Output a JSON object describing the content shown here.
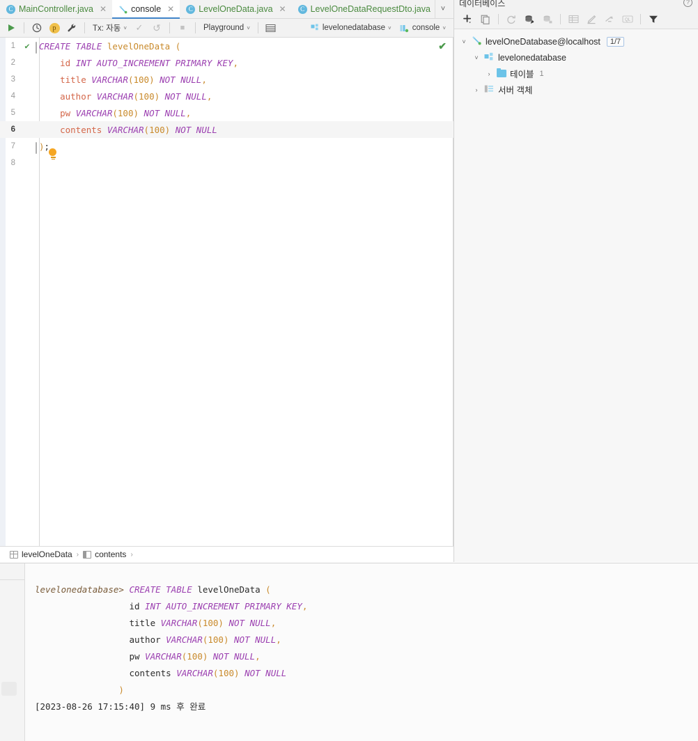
{
  "tabs": [
    {
      "label": "MainController.java",
      "icon": "java-class-icon",
      "active": false,
      "closable": true
    },
    {
      "label": "console",
      "icon": "console-query-icon",
      "active": true,
      "closable": true
    },
    {
      "label": "LevelOneData.java",
      "icon": "java-class-icon",
      "active": false,
      "closable": true
    },
    {
      "label": "LevelOneDataRequestDto.java",
      "icon": "java-class-icon",
      "active": false,
      "closable": false
    }
  ],
  "tabbar": {
    "overflow_label": "˅",
    "menu_label": "⋮"
  },
  "editor_toolbar": {
    "run_label": "▶",
    "history_label": "history-icon",
    "profile_label": "p",
    "wrench_label": "wrench-icon",
    "tx_label": "Tx: 자동",
    "commit_label": "✓",
    "rollback_label": "↺",
    "stop_label": "■",
    "schema_label": "Playground",
    "grid_label": "grid-icon",
    "datasource_label": "levelonedatabase",
    "session_label": "console",
    "caret": "˅"
  },
  "editor": {
    "ok_check": "✔",
    "line1_check": "✔",
    "lines": [
      {
        "no": "1",
        "current": false,
        "fold": true,
        "tokens": [
          {
            "t": "CREATE TABLE ",
            "c": "kw"
          },
          {
            "t": "levelOneData ",
            "c": "tbl"
          },
          {
            "t": "(",
            "c": "pun"
          }
        ]
      },
      {
        "no": "2",
        "current": false,
        "fold": false,
        "tokens": [
          {
            "t": "    id ",
            "c": "col"
          },
          {
            "t": "INT AUTO_INCREMENT PRIMARY KEY",
            "c": "kw"
          },
          {
            "t": ",",
            "c": "pun"
          }
        ]
      },
      {
        "no": "3",
        "current": false,
        "fold": false,
        "tokens": [
          {
            "t": "    title ",
            "c": "col"
          },
          {
            "t": "VARCHAR",
            "c": "kw"
          },
          {
            "t": "(",
            "c": "pun"
          },
          {
            "t": "100",
            "c": "num"
          },
          {
            "t": ") ",
            "c": "pun"
          },
          {
            "t": "NOT NULL",
            "c": "kw"
          },
          {
            "t": ",",
            "c": "pun"
          }
        ]
      },
      {
        "no": "4",
        "current": false,
        "fold": false,
        "tokens": [
          {
            "t": "    author ",
            "c": "col"
          },
          {
            "t": "VARCHAR",
            "c": "kw"
          },
          {
            "t": "(",
            "c": "pun"
          },
          {
            "t": "100",
            "c": "num"
          },
          {
            "t": ") ",
            "c": "pun"
          },
          {
            "t": "NOT NULL",
            "c": "kw"
          },
          {
            "t": ",",
            "c": "pun"
          }
        ]
      },
      {
        "no": "5",
        "current": false,
        "fold": false,
        "tokens": [
          {
            "t": "    pw ",
            "c": "col"
          },
          {
            "t": "VARCHAR",
            "c": "kw"
          },
          {
            "t": "(",
            "c": "pun"
          },
          {
            "t": "100",
            "c": "num"
          },
          {
            "t": ") ",
            "c": "pun"
          },
          {
            "t": "NOT NULL",
            "c": "kw"
          },
          {
            "t": ",",
            "c": "pun"
          }
        ]
      },
      {
        "no": "6",
        "current": true,
        "fold": false,
        "tokens": [
          {
            "t": "    contents ",
            "c": "col"
          },
          {
            "t": "VARCHAR",
            "c": "kw"
          },
          {
            "t": "(",
            "c": "pun"
          },
          {
            "t": "100",
            "c": "num"
          },
          {
            "t": ") ",
            "c": "pun"
          },
          {
            "t": "NOT NULL",
            "c": "kw"
          }
        ]
      },
      {
        "no": "7",
        "current": false,
        "fold": true,
        "tokens": [
          {
            "t": ")",
            "c": "pun"
          },
          {
            "t": ";",
            "c": "plain"
          }
        ]
      },
      {
        "no": "8",
        "current": false,
        "fold": false,
        "tokens": []
      }
    ]
  },
  "breadcrumb": {
    "items": [
      {
        "label": "levelOneData",
        "icon": "table-icon"
      },
      {
        "label": "contents",
        "icon": "column-icon"
      }
    ],
    "separator": "›"
  },
  "database_panel": {
    "title": "데이터베이스",
    "help_label": "?",
    "toolbar": [
      {
        "name": "add-icon",
        "glyph": "+"
      },
      {
        "name": "duplicate-icon",
        "glyph": "copy"
      },
      {
        "name": "refresh-icon",
        "glyph": "refresh"
      },
      {
        "name": "db-properties-icon",
        "glyph": "db-wrench"
      },
      {
        "name": "db-schemas-icon",
        "glyph": "db-list"
      },
      {
        "name": "open-table-icon",
        "glyph": "table"
      },
      {
        "name": "modify-icon",
        "glyph": "pencil"
      },
      {
        "name": "jump-to-icon",
        "glyph": "jump"
      },
      {
        "name": "query-console-icon",
        "glyph": "QL"
      },
      {
        "name": "filter-icon",
        "glyph": "filter"
      }
    ],
    "tree": [
      {
        "label": "levelOneDatabase@localhost",
        "icon": "datasource-icon",
        "expanded": true,
        "indent": 0,
        "badge": "1/7"
      },
      {
        "label": "levelonedatabase",
        "icon": "schema-icon",
        "expanded": true,
        "indent": 1,
        "badge": ""
      },
      {
        "label": "테이블",
        "icon": "folder-icon",
        "expanded": false,
        "indent": 2,
        "count": "1"
      },
      {
        "label": "서버 객체",
        "icon": "server-objects-icon",
        "expanded": false,
        "indent": 1,
        "count": ""
      }
    ]
  },
  "console_output": {
    "lines": [
      {
        "tokens": [
          {
            "t": "levelonedatabase> ",
            "c": "cs-prompt"
          },
          {
            "t": "CREATE TABLE ",
            "c": "kw"
          },
          {
            "t": "levelOneData ",
            "c": "plain"
          },
          {
            "t": "(",
            "c": "pun"
          }
        ]
      },
      {
        "tokens": [
          {
            "t": "                  id ",
            "c": "plain"
          },
          {
            "t": "INT AUTO_INCREMENT PRIMARY KEY",
            "c": "kw"
          },
          {
            "t": ",",
            "c": "pun"
          }
        ]
      },
      {
        "tokens": [
          {
            "t": "                  title ",
            "c": "plain"
          },
          {
            "t": "VARCHAR",
            "c": "kw"
          },
          {
            "t": "(",
            "c": "pun"
          },
          {
            "t": "100",
            "c": "num"
          },
          {
            "t": ") ",
            "c": "pun"
          },
          {
            "t": "NOT NULL",
            "c": "kw"
          },
          {
            "t": ",",
            "c": "pun"
          }
        ]
      },
      {
        "tokens": [
          {
            "t": "                  author ",
            "c": "plain"
          },
          {
            "t": "VARCHAR",
            "c": "kw"
          },
          {
            "t": "(",
            "c": "pun"
          },
          {
            "t": "100",
            "c": "num"
          },
          {
            "t": ") ",
            "c": "pun"
          },
          {
            "t": "NOT NULL",
            "c": "kw"
          },
          {
            "t": ",",
            "c": "pun"
          }
        ]
      },
      {
        "tokens": [
          {
            "t": "                  pw ",
            "c": "plain"
          },
          {
            "t": "VARCHAR",
            "c": "kw"
          },
          {
            "t": "(",
            "c": "pun"
          },
          {
            "t": "100",
            "c": "num"
          },
          {
            "t": ") ",
            "c": "pun"
          },
          {
            "t": "NOT NULL",
            "c": "kw"
          },
          {
            "t": ",",
            "c": "pun"
          }
        ]
      },
      {
        "tokens": [
          {
            "t": "                  contents ",
            "c": "plain"
          },
          {
            "t": "VARCHAR",
            "c": "kw"
          },
          {
            "t": "(",
            "c": "pun"
          },
          {
            "t": "100",
            "c": "num"
          },
          {
            "t": ") ",
            "c": "pun"
          },
          {
            "t": "NOT NULL",
            "c": "kw"
          }
        ]
      },
      {
        "tokens": [
          {
            "t": "                )",
            "c": "pun"
          }
        ]
      },
      {
        "tokens": [
          {
            "t": "[2023-08-26 17:15:40] 9 ms 후 완료",
            "c": "plain"
          }
        ]
      }
    ]
  },
  "colors": {
    "keyword": "#9b3fb0",
    "table": "#c98a2b",
    "column": "#d4674a",
    "accent_tab": "#4083c9",
    "success": "#4c9a4c",
    "bulb": "#f5a623",
    "folder": "#6cc3e8"
  }
}
